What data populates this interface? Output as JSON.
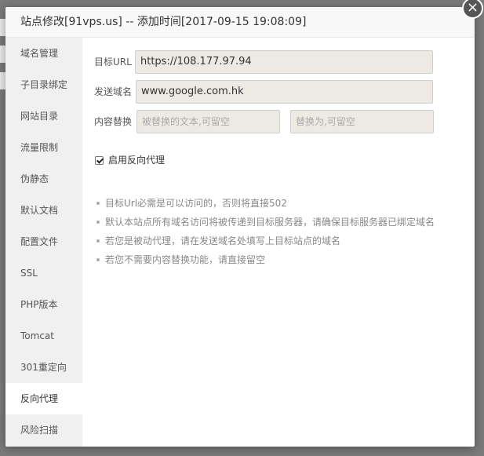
{
  "dialog": {
    "title": "站点修改[91vps.us] -- 添加时间[2017-09-15 19:08:09]",
    "close_label": "×"
  },
  "sidebar": {
    "items": [
      {
        "label": "域名管理"
      },
      {
        "label": "子目录绑定"
      },
      {
        "label": "网站目录"
      },
      {
        "label": "流量限制"
      },
      {
        "label": "伪静态"
      },
      {
        "label": "默认文档"
      },
      {
        "label": "配置文件"
      },
      {
        "label": "SSL"
      },
      {
        "label": "PHP版本"
      },
      {
        "label": "Tomcat"
      },
      {
        "label": "301重定向"
      },
      {
        "label": "反向代理",
        "active": true
      },
      {
        "label": "风险扫描"
      }
    ]
  },
  "form": {
    "target_url_label": "目标URL",
    "target_url_value": "https://108.177.97.94",
    "send_domain_label": "发送域名",
    "send_domain_value": "www.google.com.hk",
    "replace_label": "内容替换",
    "replace_from_placeholder": "被替换的文本,可留空",
    "replace_to_placeholder": "替换为,可留空",
    "enable_proxy_label": "启用反向代理",
    "enable_proxy_checked": true
  },
  "tips": [
    "目标Url必需是可以访问的，否则将直接502",
    "默认本站点所有域名访问将被传递到目标服务器，请确保目标服务器已绑定域名",
    "若您是被动代理，请在发送域名处填写上目标站点的域名",
    "若您不需要内容替换功能，请直接留空"
  ]
}
